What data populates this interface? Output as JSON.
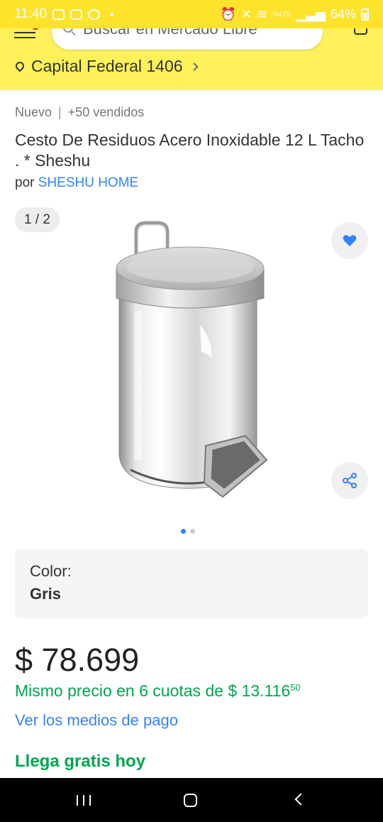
{
  "status_bar": {
    "time": "11:40",
    "lte": "VoLTE",
    "battery": "64%"
  },
  "header": {
    "search_placeholder": "Buscar en Mercado Libre",
    "location": "Capital Federal 1406",
    "brand_color": "#fff159"
  },
  "product": {
    "condition": "Nuevo",
    "sold": "+50 vendidos",
    "title": "Cesto De Residuos Acero Inoxidable 12 L Tacho  . * Sheshu",
    "seller_prefix": "por",
    "seller_name": "SHESHU HOME"
  },
  "gallery": {
    "counter": "1 / 2",
    "image_count": 2,
    "active_index": 0
  },
  "variation": {
    "label": "Color:",
    "value": "Gris"
  },
  "pricing": {
    "price": "$ 78.699",
    "installments_prefix": "Mismo precio en 6 cuotas de $ 13.116",
    "installments_cents": "50",
    "payment_link": "Ver los medios de pago",
    "shipping": "Llega gratis hoy"
  },
  "colors": {
    "accent_blue": "#3483fa",
    "green": "#00a650"
  }
}
